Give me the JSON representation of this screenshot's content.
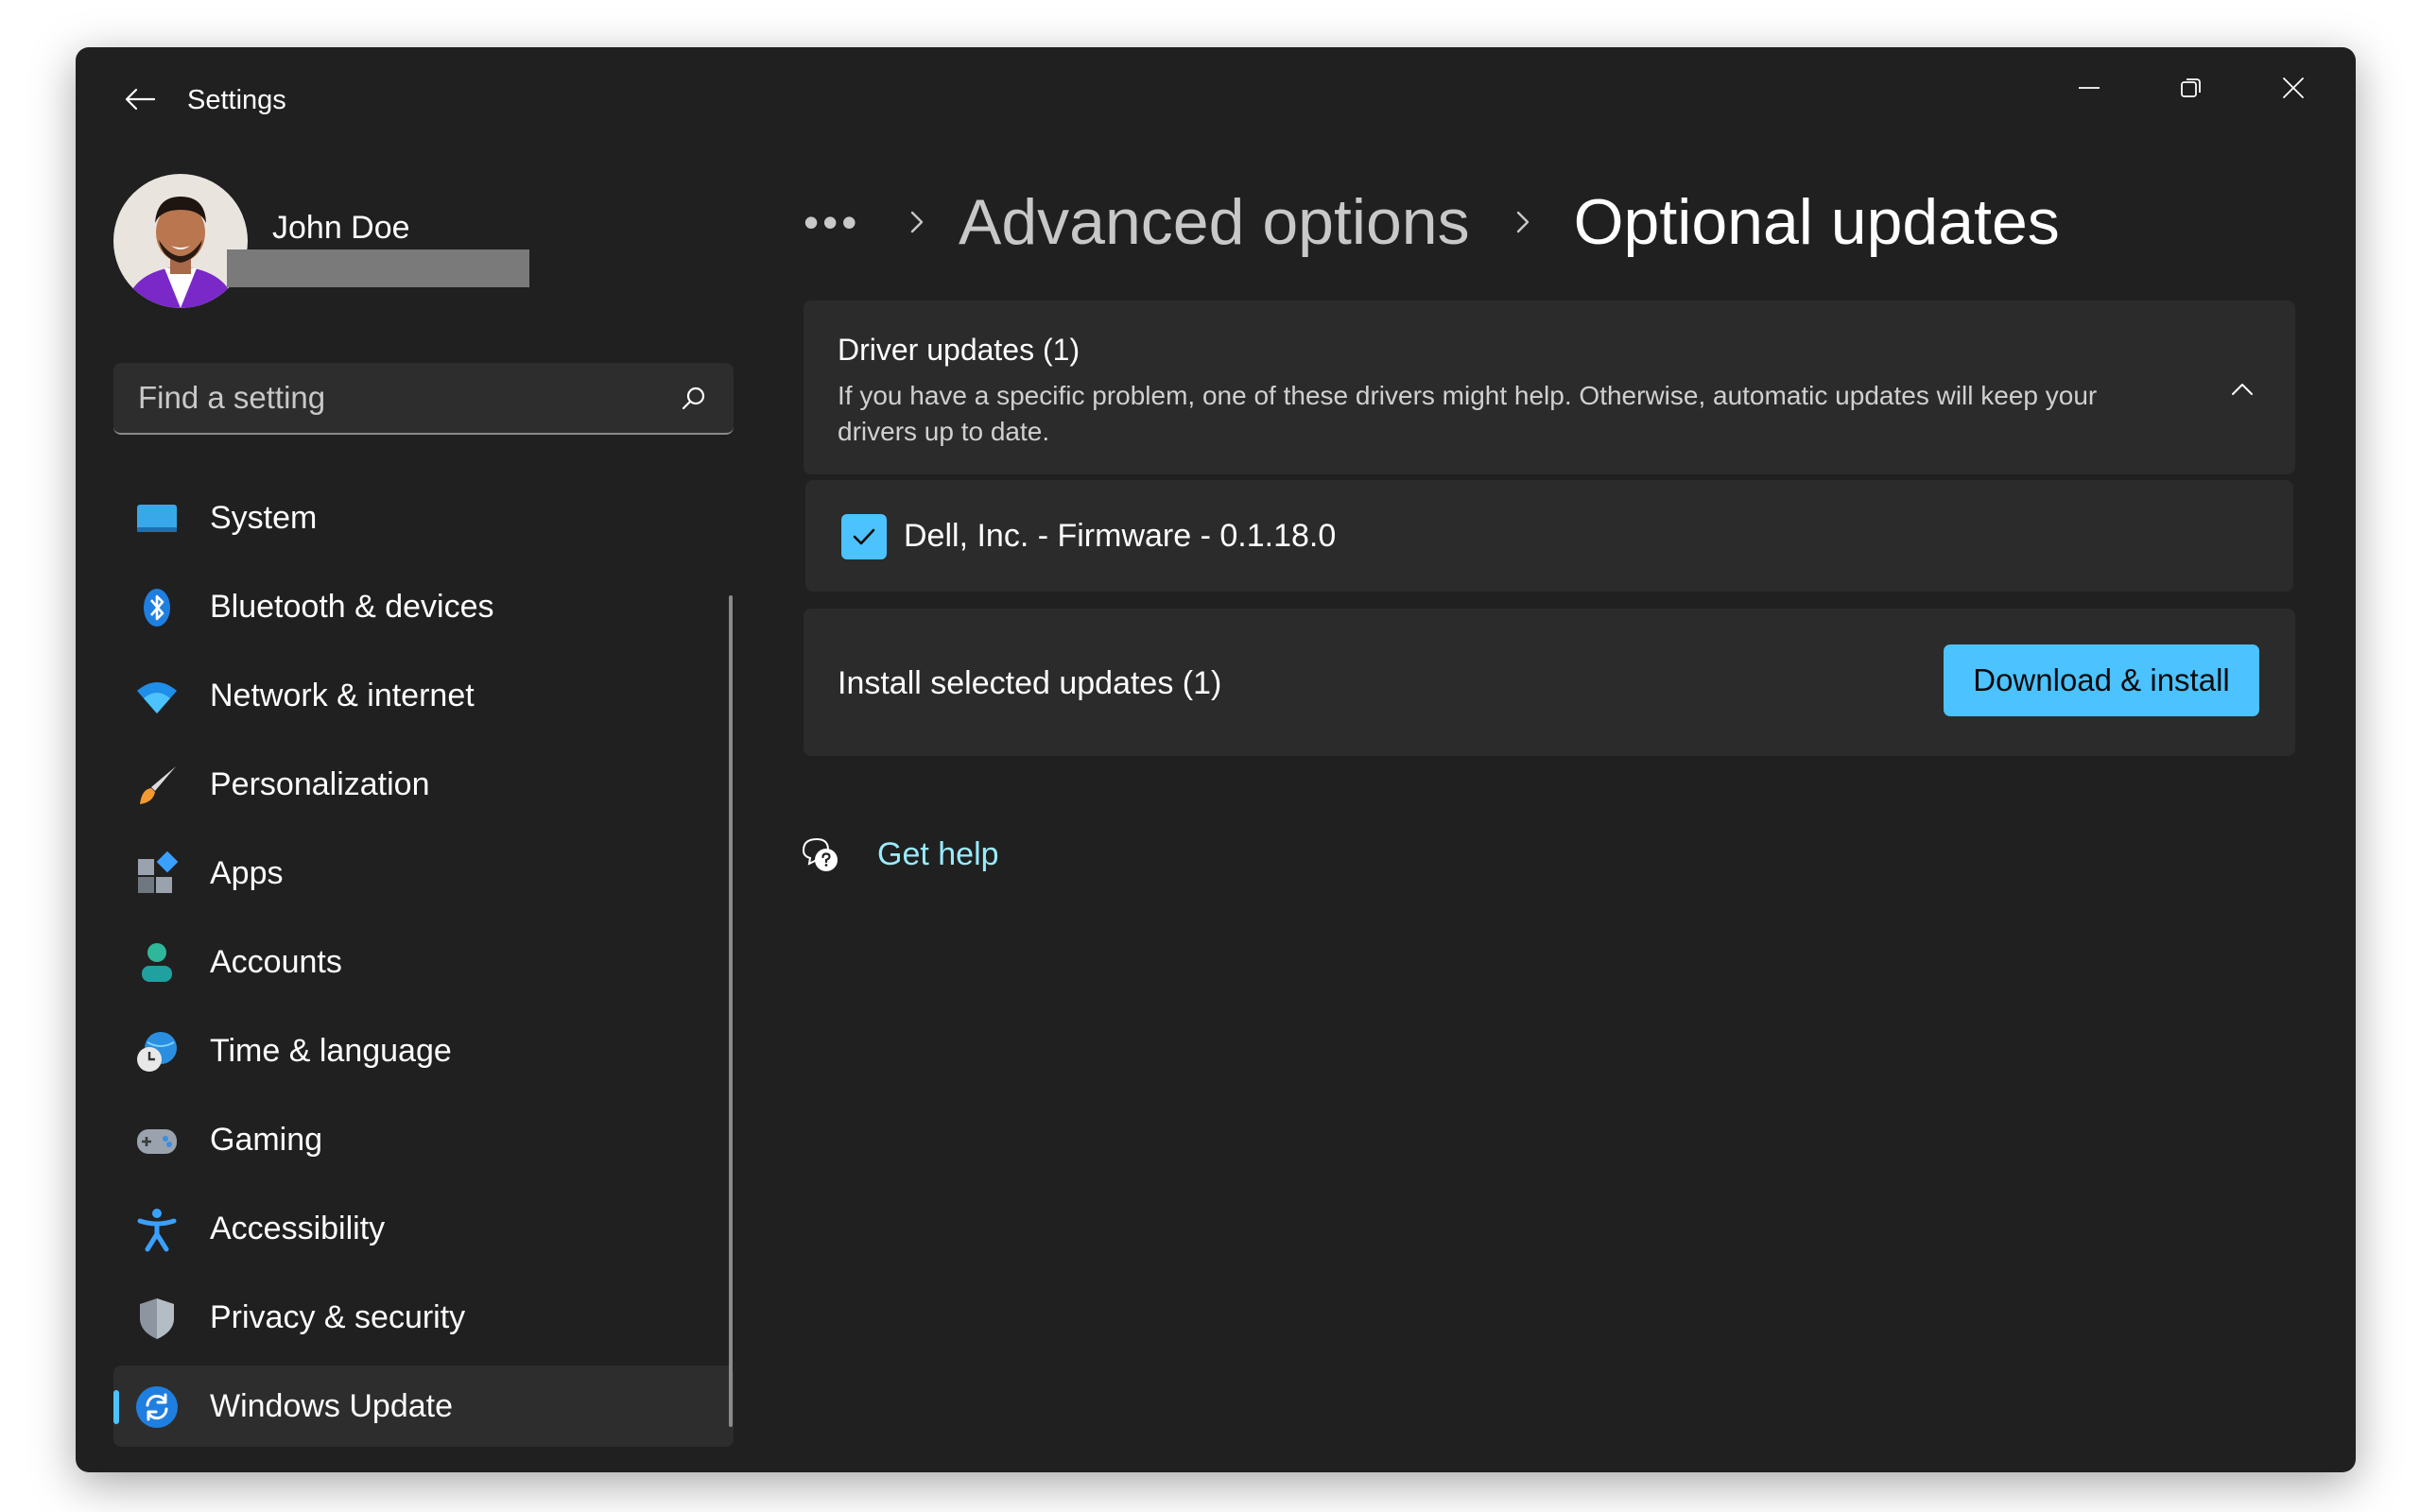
{
  "titlebar": {
    "app_title": "Settings",
    "back_icon": "back-arrow-icon",
    "minimize_icon": "minimize-icon",
    "maximize_icon": "restore-icon",
    "close_icon": "close-icon"
  },
  "profile": {
    "name": "John Doe",
    "avatar_icon": "user-photo"
  },
  "search": {
    "placeholder": "Find a setting",
    "icon": "search-icon"
  },
  "sidebar": {
    "items": [
      {
        "label": "System",
        "icon": "system-icon"
      },
      {
        "label": "Bluetooth & devices",
        "icon": "bluetooth-icon"
      },
      {
        "label": "Network & internet",
        "icon": "wifi-icon"
      },
      {
        "label": "Personalization",
        "icon": "brush-icon"
      },
      {
        "label": "Apps",
        "icon": "apps-icon"
      },
      {
        "label": "Accounts",
        "icon": "accounts-icon"
      },
      {
        "label": "Time & language",
        "icon": "clock-globe-icon"
      },
      {
        "label": "Gaming",
        "icon": "gamepad-icon"
      },
      {
        "label": "Accessibility",
        "icon": "accessibility-icon"
      },
      {
        "label": "Privacy & security",
        "icon": "shield-icon"
      },
      {
        "label": "Windows Update",
        "icon": "windows-update-icon",
        "selected": true
      }
    ]
  },
  "breadcrumb": {
    "more": "•••",
    "parent": "Advanced options",
    "current": "Optional updates"
  },
  "driver_updates": {
    "title": "Driver updates (1)",
    "description": "If you have a specific problem, one of these drivers might help. Otherwise, automatic updates will keep your drivers up to date.",
    "expanded": true,
    "items": [
      {
        "label": "Dell, Inc. - Firmware - 0.1.18.0",
        "checked": true
      }
    ]
  },
  "install": {
    "label": "Install selected updates (1)",
    "button": "Download & install"
  },
  "help": {
    "link": "Get help",
    "icon": "help-chat-icon"
  },
  "colors": {
    "accent": "#4cc2ff",
    "window_bg": "#202020",
    "card_bg": "#2b2b2b",
    "link": "#99ebff"
  }
}
